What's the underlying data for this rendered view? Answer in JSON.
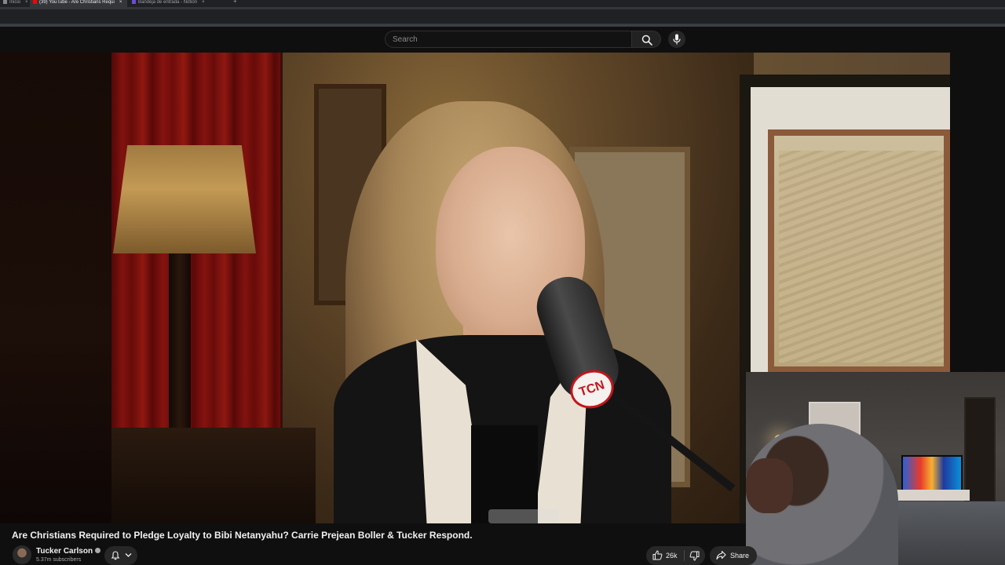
{
  "browser": {
    "tabs": [
      {
        "label": "Inicio",
        "close": "×"
      },
      {
        "label": "(39) YouTube - Are Christians Requi",
        "close": "×"
      },
      {
        "label": "Bandeja de entrada - Notion",
        "close": "×"
      }
    ],
    "new_tab": "+"
  },
  "masthead": {
    "search_placeholder": "Search",
    "search_icon": "search-icon",
    "mic_icon": "microphone-icon"
  },
  "video": {
    "description": "Interview video frame with webcam reaction overlay",
    "logo_text": "TCN"
  },
  "meta": {
    "title": "Are Christians Required to Pledge Loyalty to Bibi Netanyahu? Carrie Prejean Boller & Tucker Respond.",
    "channel_name": "Tucker Carlson",
    "subscribers": "5.37m subscribers",
    "likes": "26k",
    "share_label": "Share"
  },
  "colors": {
    "background": "#0f0f0f",
    "button_bg": "#272727",
    "text": "#f1f1f1",
    "muted": "#aaaaaa",
    "logo_red": "#c4151c"
  }
}
